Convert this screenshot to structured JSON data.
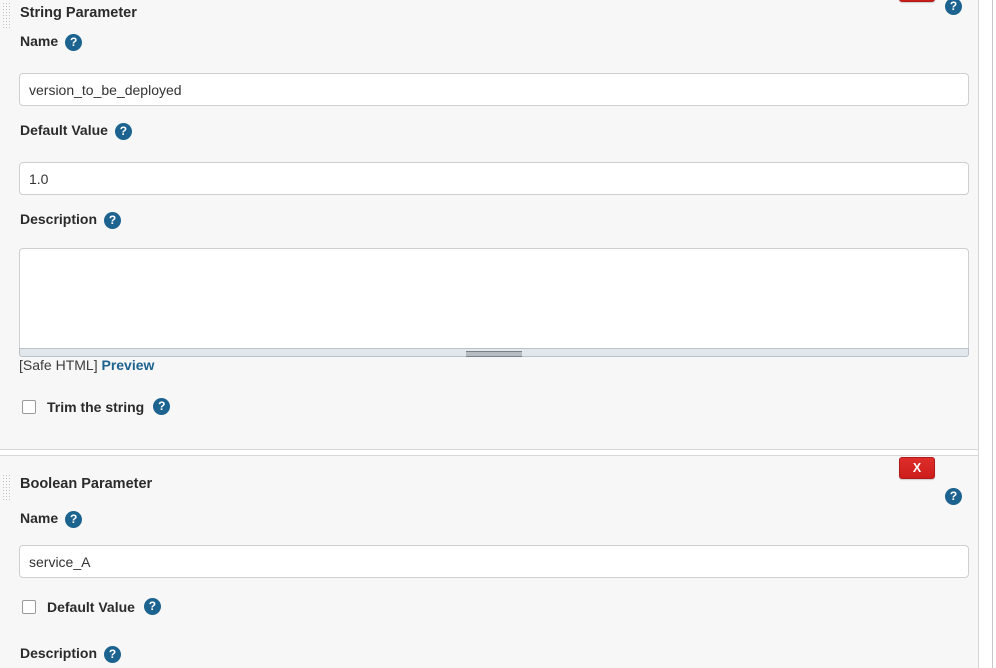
{
  "colors": {
    "accent_blue": "#1d6390",
    "delete_red": "#d62728",
    "block_bg": "#f7f7f7",
    "field_border": "#cfcfcf"
  },
  "icons": {
    "help": "?",
    "delete": "X"
  },
  "parameters": [
    {
      "title": "String Parameter",
      "delete_label": "X",
      "name": {
        "label": "Name",
        "value": "version_to_be_deployed",
        "placeholder": ""
      },
      "default_value": {
        "label": "Default Value",
        "value": "1.0",
        "placeholder": ""
      },
      "description": {
        "label": "Description",
        "value": "",
        "placeholder": ""
      },
      "safe_html": {
        "text": "[Safe HTML]",
        "preview_label": "Preview"
      },
      "trim": {
        "label": "Trim the string",
        "checked": false
      }
    },
    {
      "title": "Boolean Parameter",
      "delete_label": "X",
      "name": {
        "label": "Name",
        "value": "service_A",
        "placeholder": ""
      },
      "default_value": {
        "label": "Default Value",
        "checked": false
      },
      "description": {
        "label": "Description",
        "value": "",
        "placeholder": ""
      }
    }
  ]
}
